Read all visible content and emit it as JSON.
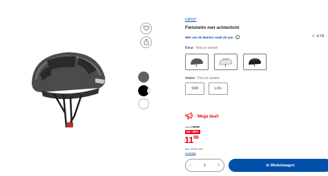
{
  "product": {
    "brand": "CRIVIT",
    "title": "Fietshelm met achterlicht",
    "recommendation": "99% van de klanten raadt dit aan",
    "info_icon": "i",
    "rating": "4.7/5"
  },
  "colors": {
    "accent": "#0050aa",
    "sale": "#e60a14",
    "star": "#f4a300",
    "swatches": [
      "#616161",
      "#000000",
      "#ffffff"
    ]
  },
  "options": {
    "color_label": "Kleur:",
    "color_hint": "Kies je variant",
    "size_label": "maten:",
    "size_hint": "Kies je variant",
    "sizes": [
      "S/M",
      "L/XL"
    ]
  },
  "pricing": {
    "deal_label": "Mega deal!",
    "from_label": "vanaf",
    "old_price": "14.99",
    "discount": "tpt -40%",
    "price_main": "11",
    "price_cents": "99",
    "tax": "Incl. BTW excl.",
    "delivery": "Levering"
  },
  "cart": {
    "quantity": "1",
    "minus": "−",
    "plus": "+",
    "button": "In Winkelwagen"
  },
  "icons": {
    "favorite": "heart-icon",
    "share": "share-icon",
    "deal": "megaphone-icon",
    "rating": "star-icon"
  }
}
